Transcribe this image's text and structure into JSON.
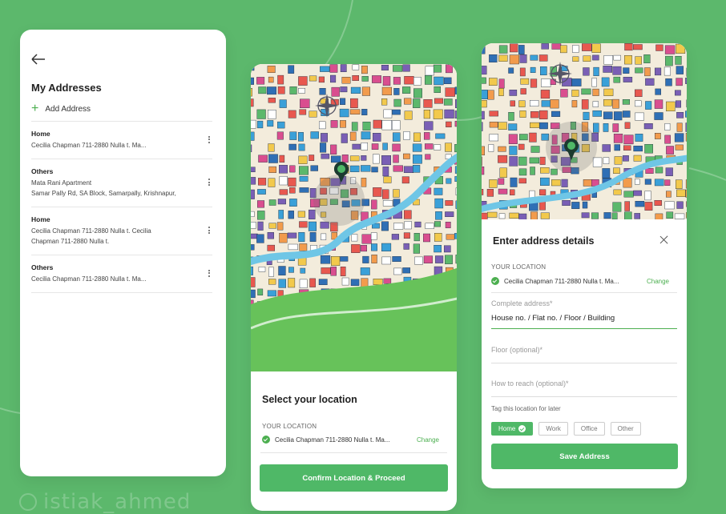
{
  "colors": {
    "background": "#5cb86c",
    "accent": "#4fb867",
    "card": "#ffffff"
  },
  "watermark": "istiak_ahmed",
  "screen1": {
    "back_icon": "arrow-left-icon",
    "title": "My Addresses",
    "add_label": "Add Address",
    "addresses": [
      {
        "type": "Home",
        "lines": [
          "Cecilia Chapman  711-2880 Nulla t. Ma..."
        ]
      },
      {
        "type": "Others",
        "lines": [
          "Mata Rani Apartment",
          "Samar Pally Rd, SA Block, Samarpally, Krishnapur,"
        ]
      },
      {
        "type": "Home",
        "lines": [
          "Cecilia Chapman  711-2880 Nulla t. Cecilia",
          "Chapman  711-2880 Nulla t."
        ]
      },
      {
        "type": "Others",
        "lines": [
          "Cecilia Chapman  711-2880 Nulla t. Ma..."
        ]
      }
    ]
  },
  "screen2": {
    "title": "Select your location",
    "location_caption": "YOUR LOCATION",
    "location_value": "Cecilia Chapman  711-2880 Nulla t. Ma...",
    "change_label": "Change",
    "confirm_label": "Confirm Location & Proceed"
  },
  "screen3": {
    "title": "Enter address details",
    "location_caption": "YOUR LOCATION",
    "location_value": "Cecilia Chapman  711-2880 Nulla t. Ma...",
    "change_label": "Change",
    "complete_address_placeholder": "Complete address*",
    "complete_address_value": "House no. / Flat no. / Floor / Building",
    "floor_placeholder": "Floor (optional)*",
    "reach_placeholder": "How to reach (optional)*",
    "tag_caption": "Tag this location for later",
    "tags": [
      "Home",
      "Work",
      "Office",
      "Other"
    ],
    "selected_tag": "Home",
    "save_label": "Save  Address"
  }
}
